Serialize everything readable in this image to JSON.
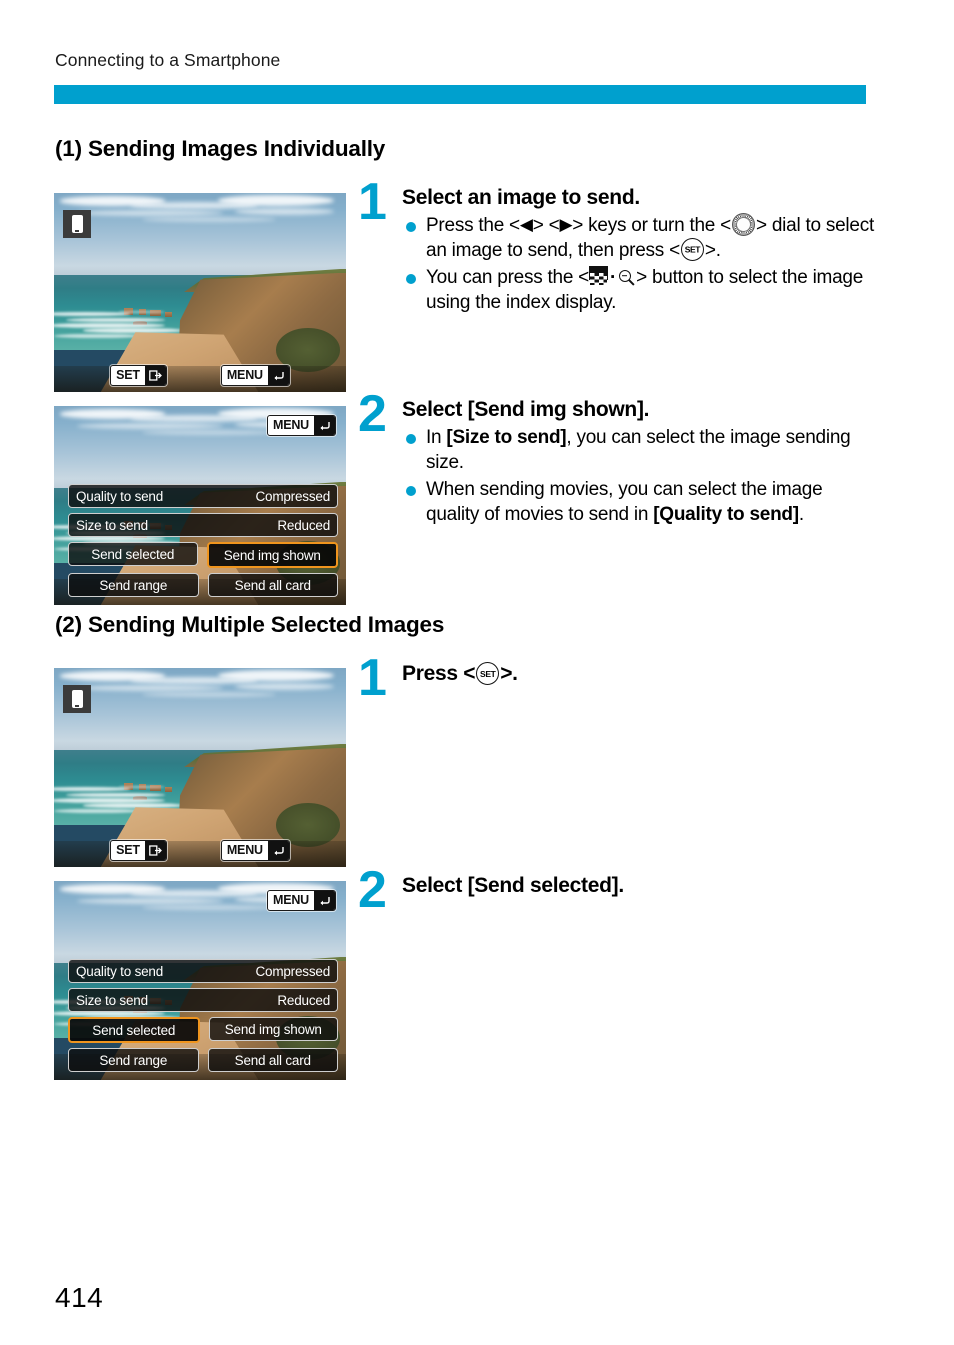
{
  "header": {
    "running_head": "Connecting to a Smartphone",
    "rule_color": "#00a0ce"
  },
  "sections": [
    {
      "heading": "(1) Sending Images Individually",
      "steps": [
        {
          "number": "1",
          "title": "Select an image to send.",
          "bullets": [
            "Press the <◀> <▶> keys or turn the <dial> dial to select an image to send, then press <SET>.",
            "You can press the <index·magnify> button to select the image using the index display."
          ]
        },
        {
          "number": "2",
          "title": "Select [Send img shown].",
          "bullets": [
            "In [Size to send], you can select the image sending size.",
            "When sending movies, you can select the image quality of movies to send in [Quality to send]."
          ]
        }
      ]
    },
    {
      "heading": "(2) Sending Multiple Selected Images",
      "steps": [
        {
          "number": "1",
          "title": "Press <SET>.",
          "bullets": []
        },
        {
          "number": "2",
          "title": "Select [Send selected].",
          "bullets": []
        }
      ]
    }
  ],
  "step_text": {
    "s1_1_title": "Select an image to send.",
    "s1_1_b1_a": "Press the <",
    "s1_1_b1_left": "◀",
    "s1_1_b1_b": "> <",
    "s1_1_b1_right": "▶",
    "s1_1_b1_c": "> keys or turn the <",
    "s1_1_b1_d": "> dial to select an image to send, then press <",
    "s1_1_b1_e": ">.",
    "s1_1_b2_a": "You can press the <",
    "s1_1_b2_b": "> button to select the image using the index display.",
    "s1_2_title_pre": "Select [",
    "s1_2_title_item": "Send img shown",
    "s1_2_title_post": "].",
    "s1_2_b1_a": "In ",
    "s1_2_b1_item": "[Size to send]",
    "s1_2_b1_b": ", you can select the image sending size.",
    "s1_2_b2_a": "When sending movies, you can select the image quality of movies to send in ",
    "s1_2_b2_item": "[Quality to send]",
    "s1_2_b2_b": ".",
    "s2_1_title_pre": "Press <",
    "s2_1_title_post": ">.",
    "s2_2_title": "Select [Send selected]."
  },
  "camera_screens": {
    "playback": {
      "phone_badge_icon": "smartphone-icon",
      "set_chip": {
        "label": "SET",
        "glyph": "↪",
        "glyph_name": "send-image-icon"
      },
      "menu_chip": {
        "label": "MENU",
        "glyph": "↰",
        "glyph_name": "return-arrow-icon"
      }
    },
    "send_menu": {
      "menu_chip": {
        "label": "MENU",
        "glyph": "↰",
        "glyph_name": "return-arrow-icon"
      },
      "rows": [
        {
          "label": "Quality to send",
          "value": "Compressed"
        },
        {
          "label": "Size to send",
          "value": "Reduced"
        }
      ],
      "buttons": [
        "Send selected",
        "Send img shown",
        "Send range",
        "Send all card"
      ],
      "selected_top": "Send img shown",
      "selected_bottom": "Send selected",
      "highlight_color": "#f0951e"
    }
  },
  "page_number": "414"
}
